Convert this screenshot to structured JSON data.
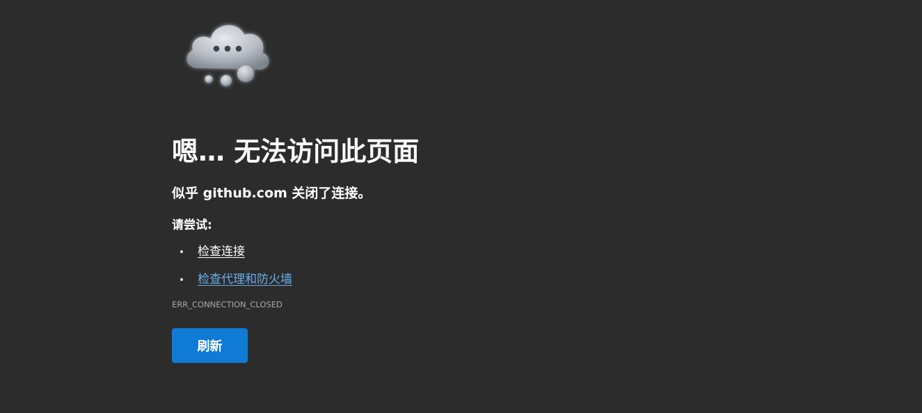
{
  "error_page": {
    "title": "嗯… 无法访问此页面",
    "subtitle": "似乎 github.com 关闭了连接。",
    "try_label": "请尝试:",
    "suggestions": [
      {
        "label": "检查连接"
      },
      {
        "label": "检查代理和防火墙"
      }
    ],
    "error_code": "ERR_CONNECTION_CLOSED",
    "refresh_label": "刷新",
    "illustration_icon": "cloud-ellipsis-icon"
  },
  "colors": {
    "background": "#2c2c2c",
    "text": "#ffffff",
    "link": "#6aaeea",
    "error_code": "#a9a9a9",
    "button": "#0f7bd6"
  }
}
